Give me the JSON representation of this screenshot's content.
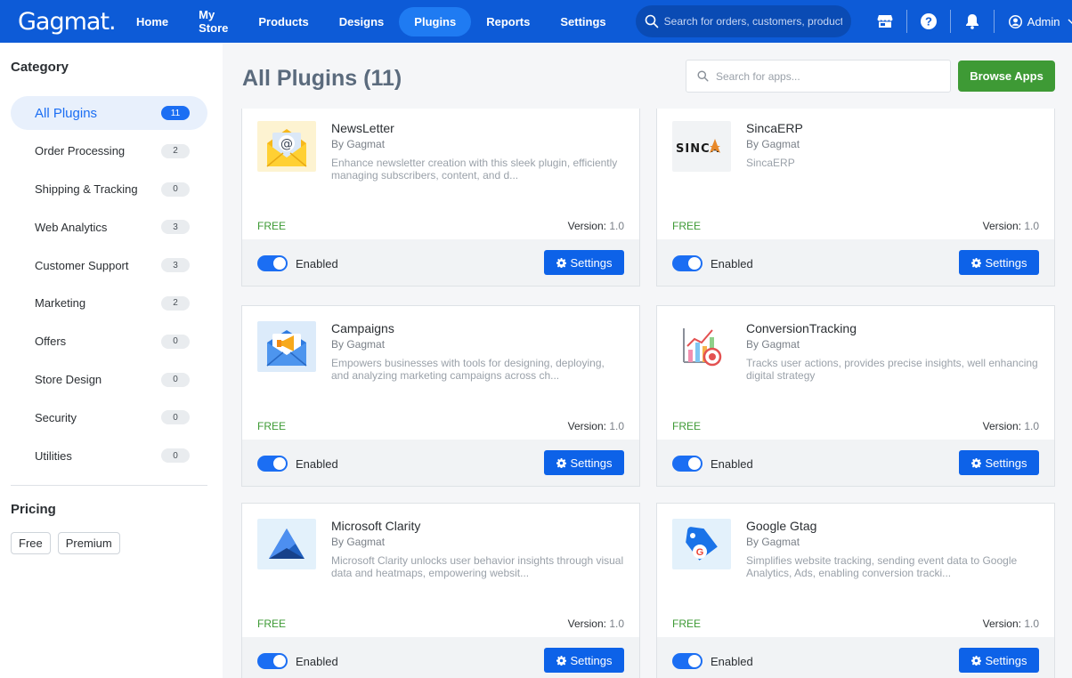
{
  "app": {
    "logo": "Gagmat."
  },
  "nav": {
    "items": [
      {
        "label": "Home"
      },
      {
        "label": "My Store"
      },
      {
        "label": "Products"
      },
      {
        "label": "Designs"
      },
      {
        "label": "Plugins",
        "active": true
      },
      {
        "label": "Reports"
      },
      {
        "label": "Settings"
      }
    ],
    "search_placeholder": "Search for orders, customers, products",
    "user": "Admin"
  },
  "sidebar": {
    "category_heading": "Category",
    "categories": [
      {
        "label": "All Plugins",
        "count": "11",
        "active": true
      },
      {
        "label": "Order Processing",
        "count": "2"
      },
      {
        "label": "Shipping & Tracking",
        "count": "0"
      },
      {
        "label": "Web Analytics",
        "count": "3"
      },
      {
        "label": "Customer Support",
        "count": "3"
      },
      {
        "label": "Marketing",
        "count": "2"
      },
      {
        "label": "Offers",
        "count": "0"
      },
      {
        "label": "Store Design",
        "count": "0"
      },
      {
        "label": "Security",
        "count": "0"
      },
      {
        "label": "Utilities",
        "count": "0"
      }
    ],
    "pricing_heading": "Pricing",
    "pricing_options": [
      "Free",
      "Premium"
    ]
  },
  "main": {
    "title": "All Plugins (11)",
    "search_placeholder": "Search for apps...",
    "browse_label": "Browse Apps",
    "price_label": "FREE",
    "version_label": "Version:",
    "enabled_label": "Enabled",
    "settings_label": "Settings",
    "plugins": [
      {
        "name": "NewsLetter",
        "author": "By Gagmat",
        "description": "Enhance newsletter creation with this sleek plugin, efficiently managing subscribers, content, and d...",
        "version": "1.0",
        "icon": "newsletter-envelope-icon",
        "thumb_bg": "#fdf3d1"
      },
      {
        "name": "SincaERP",
        "author": "By Gagmat",
        "description": "SincaERP",
        "version": "1.0",
        "icon": "sinca-logo",
        "thumb_bg": "#f1f3f5",
        "logo_text": "SINCA"
      },
      {
        "name": "Campaigns",
        "author": "By Gagmat",
        "description": "Empowers businesses with tools for designing, deploying, and analyzing marketing campaigns across ch...",
        "version": "1.0",
        "icon": "campaign-megaphone-icon",
        "thumb_bg": "#dcebfa"
      },
      {
        "name": "ConversionTracking",
        "author": "By Gagmat",
        "description": "Tracks user actions, provides precise insights, well enhancing digital strategy",
        "version": "1.0",
        "icon": "conversion-chart-icon",
        "thumb_bg": "#ffffff"
      },
      {
        "name": "Microsoft Clarity",
        "author": "By Gagmat",
        "description": "Microsoft Clarity unlocks user behavior insights through visual data and heatmaps, empowering websit...",
        "version": "1.0",
        "icon": "clarity-logo-icon",
        "thumb_bg": "#e3f1fb"
      },
      {
        "name": "Google Gtag",
        "author": "By Gagmat",
        "description": "Simplifies website tracking, sending event data to Google Analytics, Ads, enabling conversion tracki...",
        "version": "1.0",
        "icon": "google-tag-icon",
        "thumb_bg": "#e3f1fb"
      }
    ]
  },
  "colors": {
    "primary": "#0d5bd7",
    "button": "#0d62e8",
    "success": "#3e9a35"
  }
}
